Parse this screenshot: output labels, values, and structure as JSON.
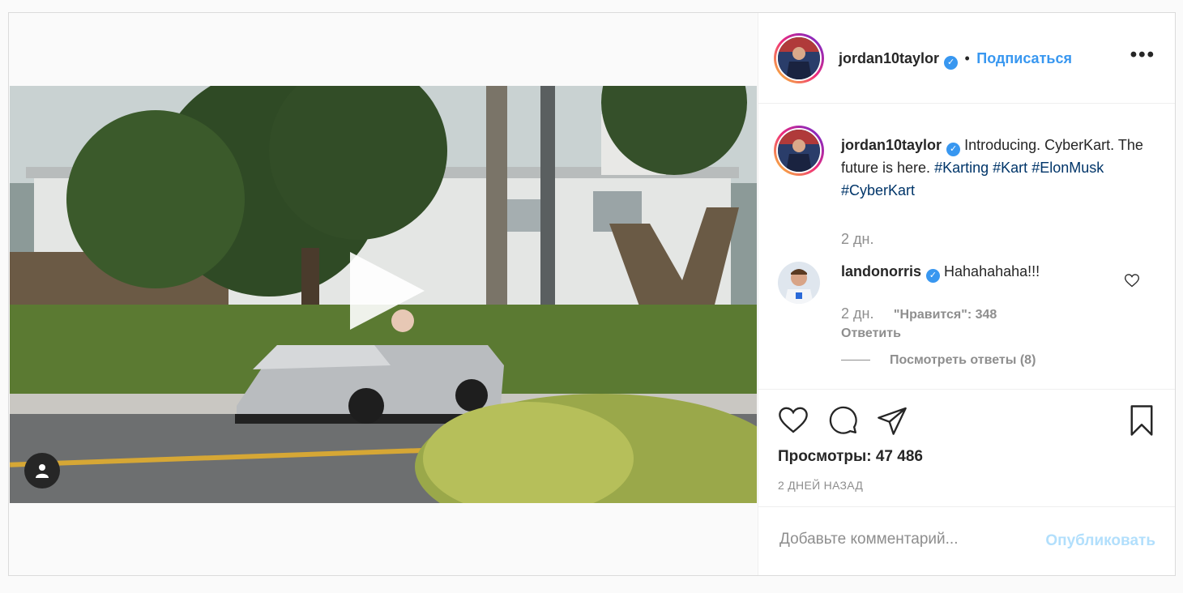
{
  "post": {
    "media": {
      "kind": "video",
      "play_icon": "play-icon",
      "tagged_users_icon": "user-icon"
    },
    "header": {
      "username": "jordan10taylor",
      "verified": true,
      "separator": "•",
      "follow_label": "Подписаться",
      "more_icon": "more-icon"
    },
    "caption": {
      "username": "jordan10taylor",
      "text": "Introducing. CyberKart. The future is here.",
      "hashtags": [
        "#Karting",
        "#Kart",
        "#ElonMusk",
        "#CyberKart"
      ],
      "time": "2 дн."
    },
    "comments": [
      {
        "username": "landonorris",
        "verified": true,
        "text": "Hahahahaha!!!",
        "time": "2 дн.",
        "likes": "\"Нравится\": 348",
        "reply_label": "Ответить",
        "view_replies": "Посмотреть ответы (8)"
      }
    ],
    "actions": {
      "like_icon": "heart-icon",
      "comment_icon": "comment-icon",
      "share_icon": "share-icon",
      "save_icon": "bookmark-icon"
    },
    "views": "Просмотры: 47 486",
    "posted_ago": "2 ДНЕЙ НАЗАД",
    "add_comment": {
      "placeholder": "Добавьте комментарий...",
      "publish_label": "Опубликовать"
    }
  },
  "colors": {
    "accent": "#3897f0",
    "hashtag": "#003569",
    "muted": "#8e8e8e",
    "publish_disabled": "#b2dffc"
  }
}
